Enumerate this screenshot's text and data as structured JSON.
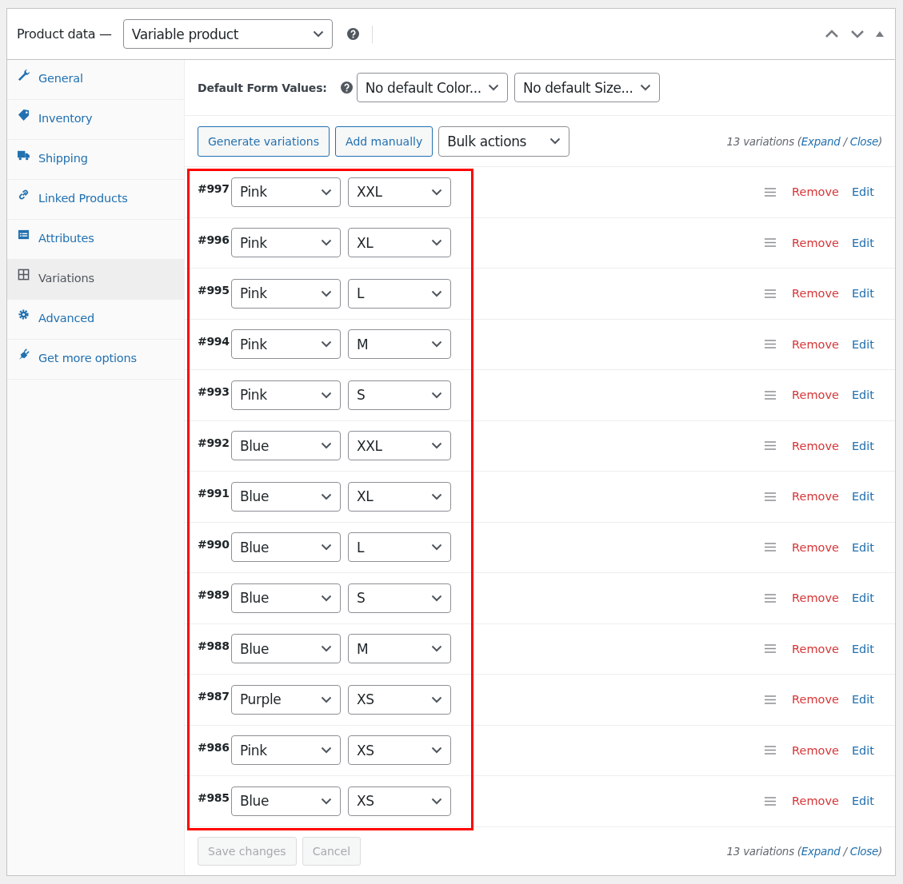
{
  "header": {
    "title": "Product data —",
    "product_type": "Variable product"
  },
  "sidebar": {
    "items": [
      {
        "label": "General",
        "selected": false
      },
      {
        "label": "Inventory",
        "selected": false
      },
      {
        "label": "Shipping",
        "selected": false
      },
      {
        "label": "Linked Products",
        "selected": false
      },
      {
        "label": "Attributes",
        "selected": false
      },
      {
        "label": "Variations",
        "selected": true
      },
      {
        "label": "Advanced",
        "selected": false
      },
      {
        "label": "Get more options",
        "selected": false
      }
    ]
  },
  "defaults": {
    "label": "Default Form Values:",
    "selects": [
      "No default Color...",
      "No default Size..."
    ]
  },
  "toolbar": {
    "buttons": [
      "Generate variations",
      "Add manually"
    ],
    "bulk": "Bulk actions"
  },
  "summary_top": {
    "prefix": "13 variations (",
    "expand": "Expand",
    "sep": " / ",
    "close": "Close",
    "suffix": ")"
  },
  "variations": [
    {
      "id": "#997",
      "options": [
        "Pink",
        "XXL"
      ],
      "remove": "Remove",
      "edit": "Edit"
    },
    {
      "id": "#996",
      "options": [
        "Pink",
        "XL"
      ],
      "remove": "Remove",
      "edit": "Edit"
    },
    {
      "id": "#995",
      "options": [
        "Pink",
        "L"
      ],
      "remove": "Remove",
      "edit": "Edit"
    },
    {
      "id": "#994",
      "options": [
        "Pink",
        "M"
      ],
      "remove": "Remove",
      "edit": "Edit"
    },
    {
      "id": "#993",
      "options": [
        "Pink",
        "S"
      ],
      "remove": "Remove",
      "edit": "Edit"
    },
    {
      "id": "#992",
      "options": [
        "Blue",
        "XXL"
      ],
      "remove": "Remove",
      "edit": "Edit"
    },
    {
      "id": "#991",
      "options": [
        "Blue",
        "XL"
      ],
      "remove": "Remove",
      "edit": "Edit"
    },
    {
      "id": "#990",
      "options": [
        "Blue",
        "L"
      ],
      "remove": "Remove",
      "edit": "Edit"
    },
    {
      "id": "#989",
      "options": [
        "Blue",
        "S"
      ],
      "remove": "Remove",
      "edit": "Edit"
    },
    {
      "id": "#988",
      "options": [
        "Blue",
        "M"
      ],
      "remove": "Remove",
      "edit": "Edit"
    },
    {
      "id": "#987",
      "options": [
        "Purple",
        "XS"
      ],
      "remove": "Remove",
      "edit": "Edit"
    },
    {
      "id": "#986",
      "options": [
        "Pink",
        "XS"
      ],
      "remove": "Remove",
      "edit": "Edit"
    },
    {
      "id": "#985",
      "options": [
        "Blue",
        "XS"
      ],
      "remove": "Remove",
      "edit": "Edit"
    }
  ],
  "footer": {
    "buttons": [
      {
        "label": "Save changes",
        "disabled": true
      },
      {
        "label": "Cancel",
        "disabled": true
      }
    ]
  },
  "summary_bottom": {
    "prefix": "13 variations (",
    "expand": "Expand",
    "sep": " / ",
    "close": "Close",
    "suffix": ")"
  }
}
